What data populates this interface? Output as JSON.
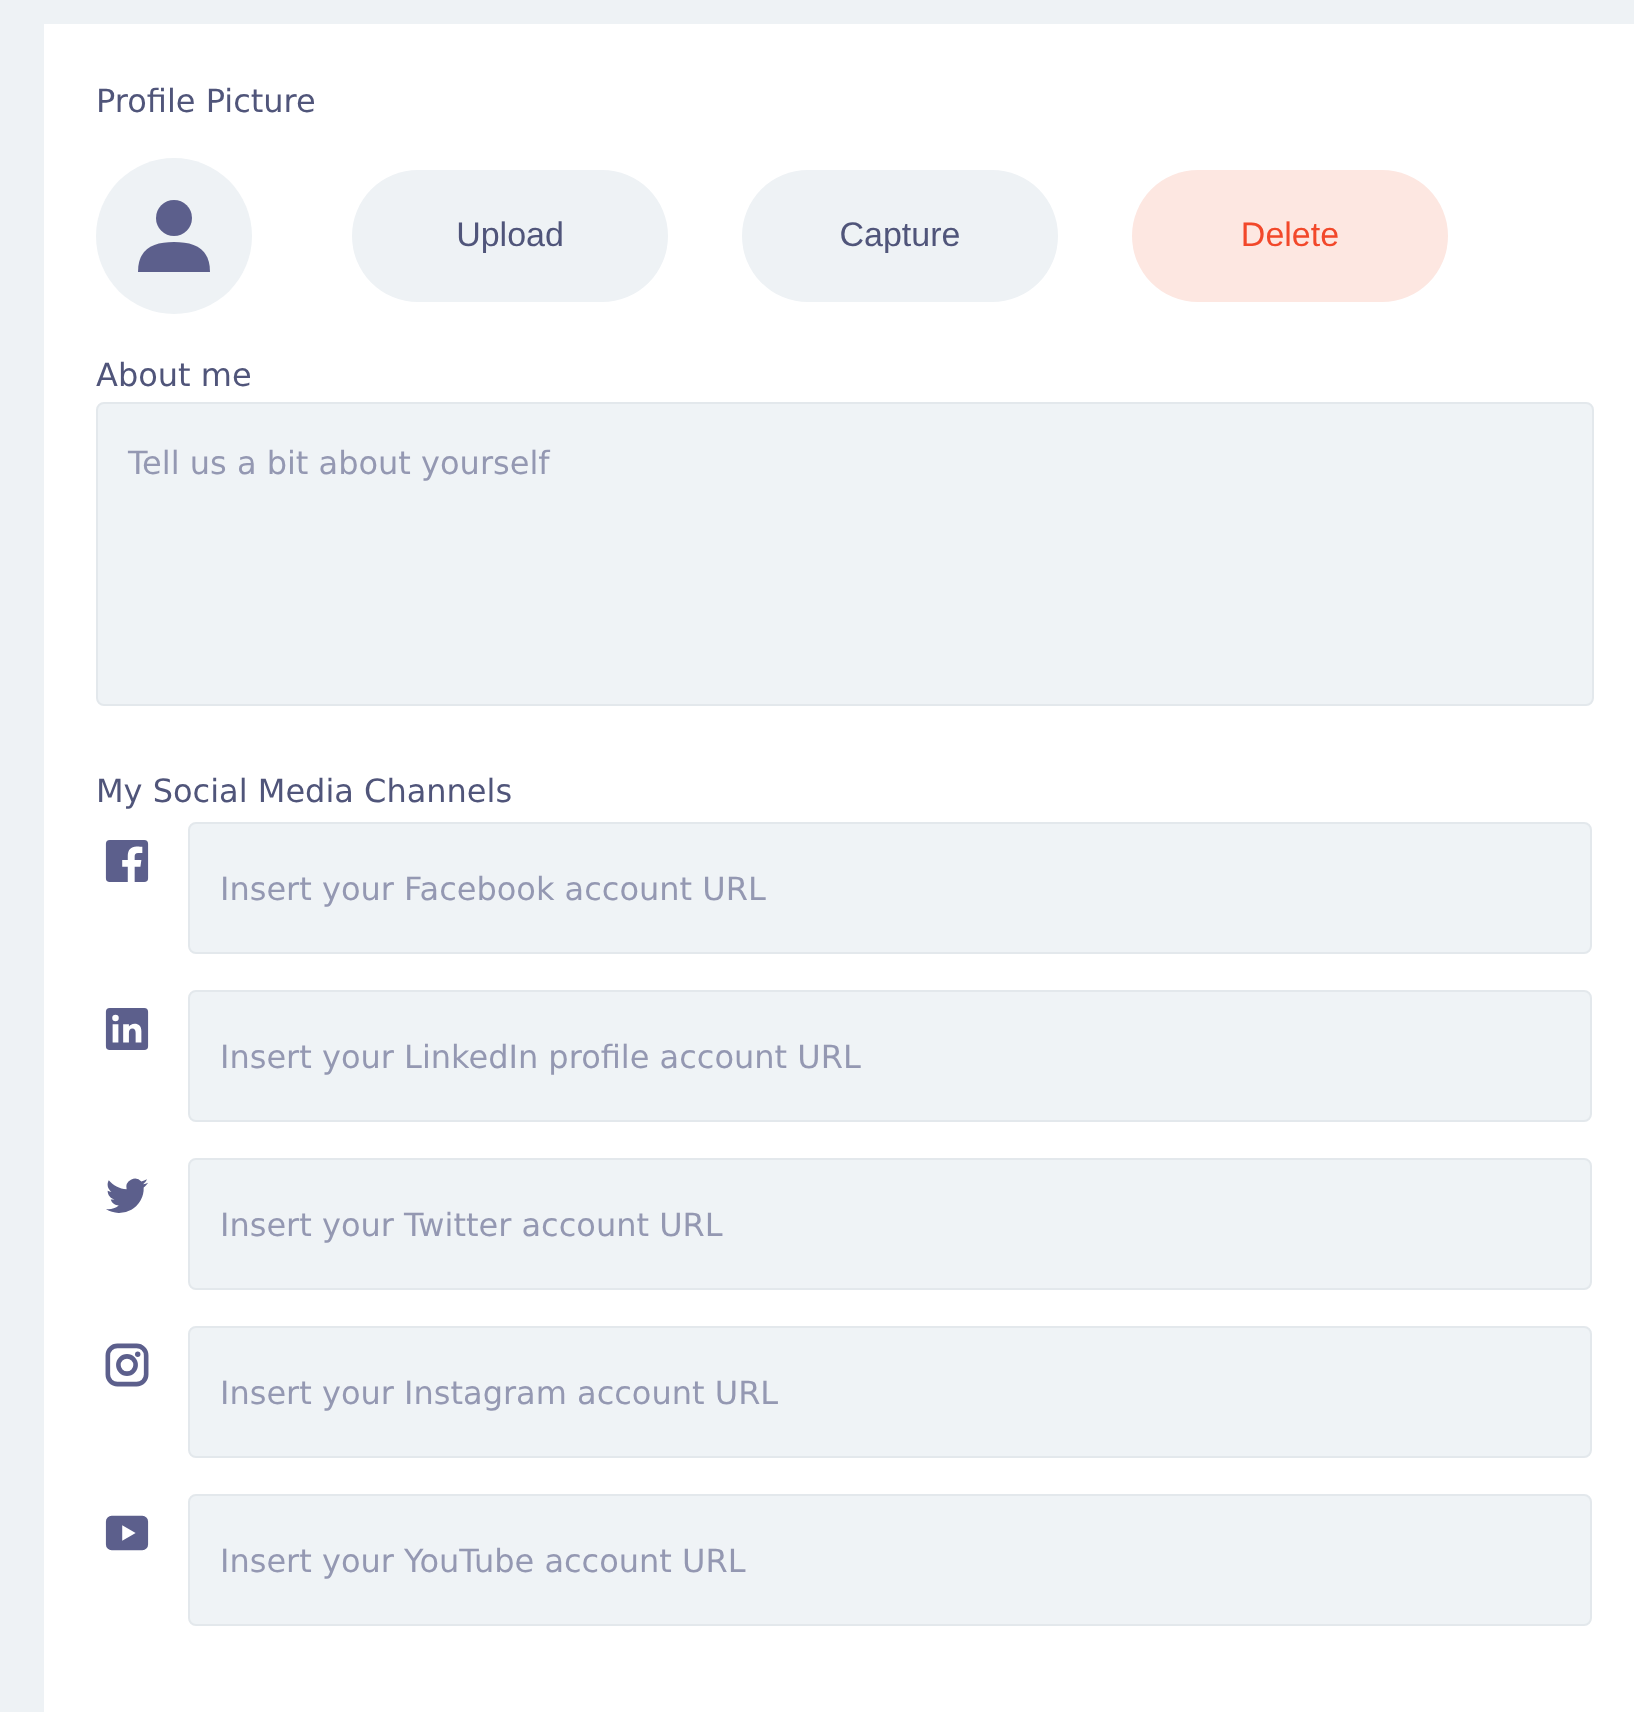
{
  "profile_picture": {
    "label": "Profile Picture",
    "buttons": [
      {
        "label": "Upload",
        "kind": "neutral"
      },
      {
        "label": "Capture",
        "kind": "neutral"
      },
      {
        "label": "Delete",
        "kind": "danger"
      }
    ]
  },
  "about_me": {
    "label": "About me",
    "placeholder": "Tell us a bit about yourself"
  },
  "social": {
    "label": "My Social Media Channels",
    "channels": [
      {
        "kind": "facebook",
        "placeholder": "Insert your Facebook account URL"
      },
      {
        "kind": "linkedin",
        "placeholder": "Insert your LinkedIn profile account URL"
      },
      {
        "kind": "twitter",
        "placeholder": "Insert your Twitter account URL"
      },
      {
        "kind": "instagram",
        "placeholder": "Insert your Instagram account URL"
      },
      {
        "kind": "youtube",
        "placeholder": "Insert your YouTube account URL"
      }
    ]
  }
}
